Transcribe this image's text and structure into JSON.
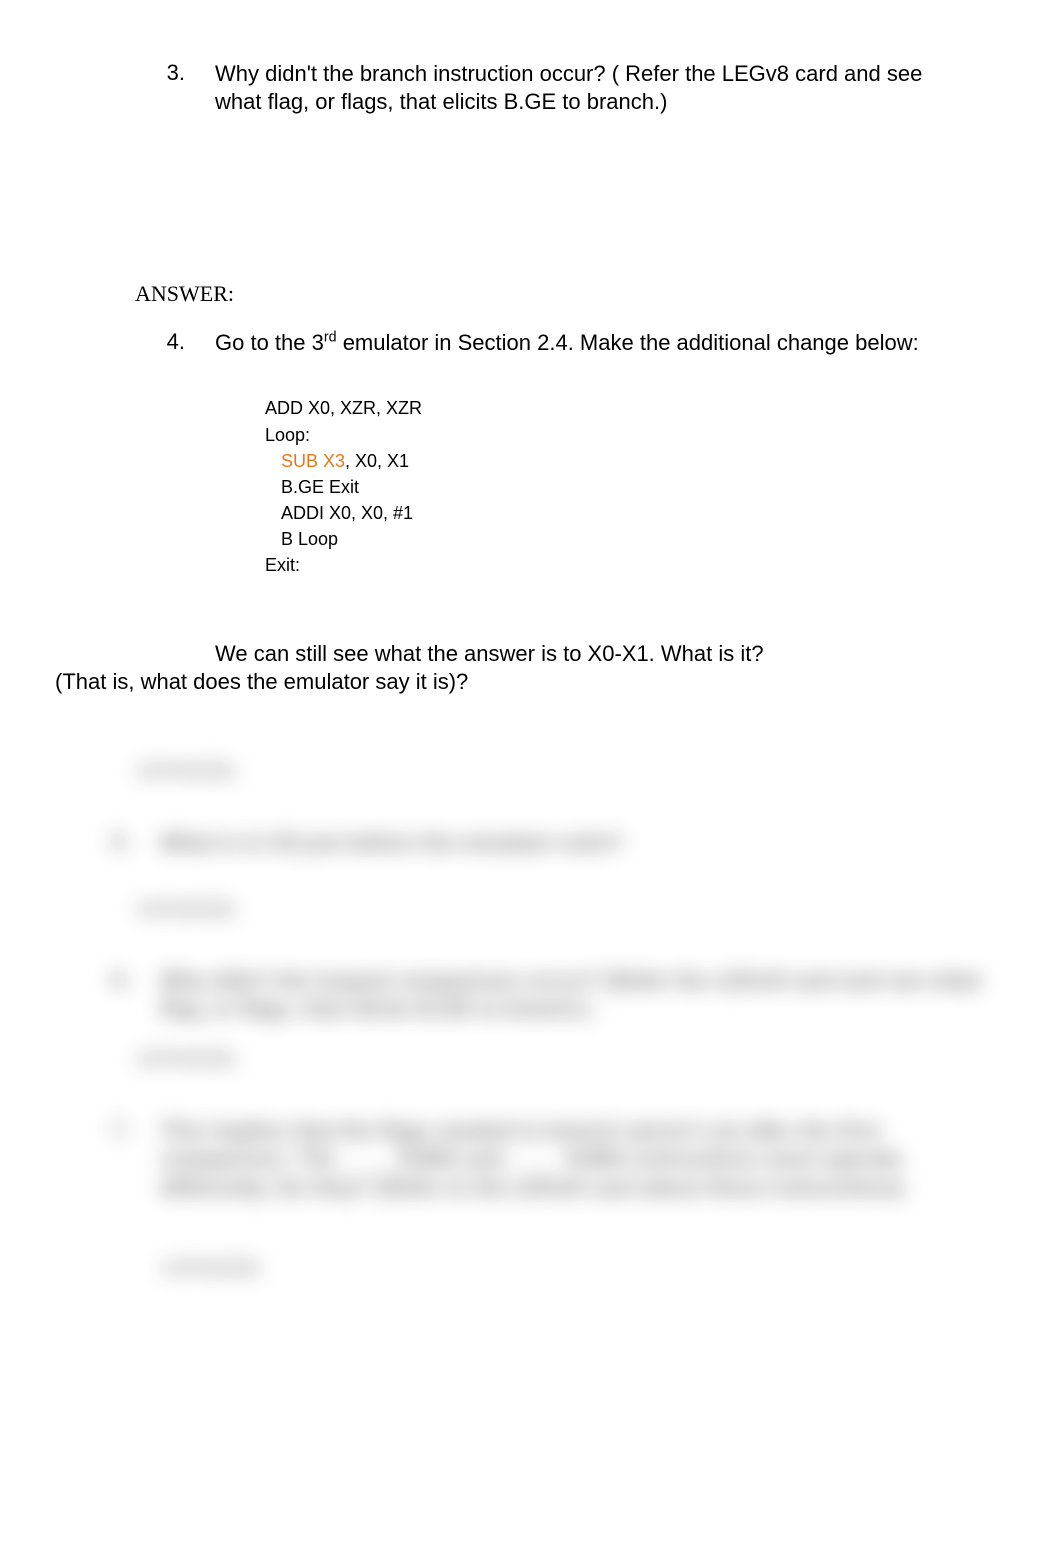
{
  "q3": {
    "number": "3.",
    "text": "Why didn't the branch instruction occur? ( Refer the LEGv8 card and see what flag, or flags, that elicits B.GE to branch.)"
  },
  "answer_label": "ANSWER:",
  "q4": {
    "number": "4.",
    "text_before_sup": "Go to the 3",
    "sup": "rd",
    "text_after_sup": " emulator in Section 2.4.  Make the additional change below:"
  },
  "code": {
    "l1": "ADD X0, XZR, XZR",
    "l2": "",
    "l3": "Loop:",
    "l4a": "SUB X3",
    "l4b": ", X0, X1",
    "l5": "B.GE Exit",
    "l6": "ADDI X0, X0, #1",
    "l7": "B Loop",
    "l8": "Exit:"
  },
  "followup": {
    "line1": "We can still see what the answer is to X0-X1. What is it?",
    "line2": "(That is, what does the emulator say it is)?"
  },
  "blurred": {
    "a1": "ANSWER:",
    "q5_num": "5.",
    "q5_text": "What is in X0 just before the emulator exits?",
    "a2": "ANSWER:",
    "q6_num": "6.",
    "q6_text": "Why didn't the looped comparison occur? (Refer the LEGv8 card and see what flag, or flags, that elicits B.GE to branch.)",
    "a3": "ANSWER:",
    "q7_num": "7.",
    "q7_text": "This implies that the flags needed to branch weren't set after the first comparison. The ____ SUBS and ____ SUBS instructions must operate differently. Do they? (Refer to the LEGv8 card about these instructions)",
    "a4": "ANSWER:"
  }
}
